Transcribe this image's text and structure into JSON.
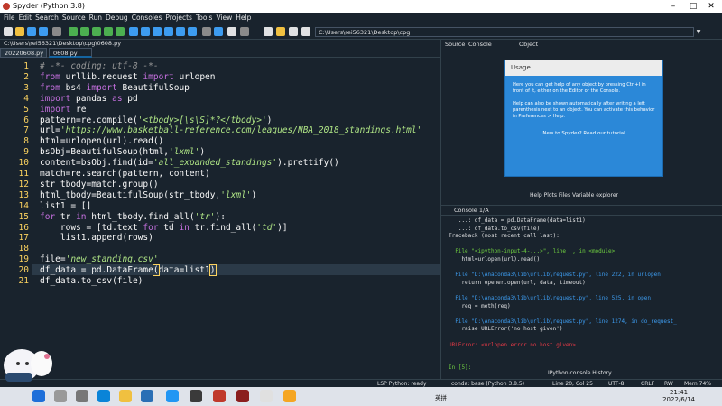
{
  "window": {
    "title": "Spyder (Python 3.8)"
  },
  "menu": [
    "File",
    "Edit",
    "Search",
    "Source",
    "Run",
    "Debug",
    "Consoles",
    "Projects",
    "Tools",
    "View",
    "Help"
  ],
  "toolbar": {
    "path": "C:\\Users\\rei56321\\Desktop\\cpg"
  },
  "editor": {
    "breadcrumb": "C:\\Users\\rei56321\\Desktop\\cpg\\0608.py",
    "tabs": [
      "20220608.py",
      "0608.py"
    ],
    "active_tab": 1,
    "lines": [
      {
        "n": "1",
        "html": "<span class='cm'># -*- coding: utf-8 -*-</span>"
      },
      {
        "n": "2",
        "html": "<span class='kw'>from</span> urllib.request <span class='kw'>import</span> urlopen"
      },
      {
        "n": "3",
        "html": "<span class='kw'>from</span> bs4 <span class='kw'>import</span> BeautifulSoup"
      },
      {
        "n": "4",
        "html": "<span class='kw'>import</span> pandas <span class='kw'>as</span> pd"
      },
      {
        "n": "5",
        "html": "<span class='kw'>import</span> re"
      },
      {
        "n": "6",
        "html": "pattern=re.compile(<span class='st'>'&lt;tbody&gt;[\\s\\S]*?&lt;/tbody&gt;'</span>)"
      },
      {
        "n": "7",
        "html": "url=<span class='st'>'https://www.basketball-reference.com/leagues/NBA_2018_standings.html'</span>"
      },
      {
        "n": "8",
        "html": "html=urlopen(url).read()"
      },
      {
        "n": "9",
        "html": "bsObj=BeautifulSoup(html,<span class='st'>'lxml'</span>)"
      },
      {
        "n": "10",
        "html": "content=bsObj.find(id=<span class='st'>'all_expanded_standings'</span>).prettify()"
      },
      {
        "n": "11",
        "html": "match=re.search(pattern, content)"
      },
      {
        "n": "12",
        "html": "str_tbody=match.group()"
      },
      {
        "n": "13",
        "html": "html_tbody=BeautifulSoup(str_tbody,<span class='st'>'lxml'</span>)"
      },
      {
        "n": "14",
        "html": "list1 = []"
      },
      {
        "n": "15",
        "html": "<span class='kw'>for</span> tr <span class='kw'>in</span> html_tbody.find_all(<span class='st'>'tr'</span>):"
      },
      {
        "n": "16",
        "html": "    rows = [td.text <span class='kw'>for</span> td <span class='kw'>in</span> tr.find_all(<span class='st'>'td'</span>)]"
      },
      {
        "n": "17",
        "html": "    list1.append(rows)"
      },
      {
        "n": "18",
        "html": ""
      },
      {
        "n": "19",
        "html": "file=<span class='st'>'new_standing.csv'</span>"
      },
      {
        "n": "20",
        "html": "df_data = pd.DataFrame<span class='hl'>(</span>data=list1<span class='hl'>)</span>"
      },
      {
        "n": "21",
        "html": "df_data.to_csv(file)"
      }
    ],
    "current_line": 20
  },
  "help_panel": {
    "tabs": [
      "Source",
      "Console",
      "Object"
    ],
    "title": "Usage",
    "p1": "Here you can get help of any object by pressing Ctrl+I in front of it, either on the Editor or the Console.",
    "p2": "Help can also be shown automatically after writing a left parenthesis next to an object. You can activate this behavior in Preferences > Help.",
    "footer": "New to Spyder? Read our tutorial",
    "bottom_tabs": "Help  Plots  Files  Variable explorer"
  },
  "console": {
    "tab": "Console 1/A",
    "lines": [
      {
        "cls": "",
        "text": "   ...: df_data = pd.DataFrame(data=list1)"
      },
      {
        "cls": "",
        "text": "   ...: df_data.to_csv(file)"
      },
      {
        "cls": "",
        "text": "Traceback (most recent call last):"
      },
      {
        "cls": "",
        "text": ""
      },
      {
        "cls": "cg",
        "text": "  File \"<ipython-input-4-...>\", line  , in <module>"
      },
      {
        "cls": "",
        "text": "    html=urlopen(url).read()"
      },
      {
        "cls": "",
        "text": ""
      },
      {
        "cls": "cb",
        "text": "  File \"D:\\Anaconda3\\lib\\urllib\\request.py\", line 222, in urlopen"
      },
      {
        "cls": "",
        "text": "    return opener.open(url, data, timeout)"
      },
      {
        "cls": "",
        "text": ""
      },
      {
        "cls": "cb",
        "text": "  File \"D:\\Anaconda3\\lib\\urllib\\request.py\", line 525, in open"
      },
      {
        "cls": "",
        "text": "    req = meth(req)"
      },
      {
        "cls": "",
        "text": ""
      },
      {
        "cls": "cb",
        "text": "  File \"D:\\Anaconda3\\lib\\urllib\\request.py\", line 1274, in do_request_"
      },
      {
        "cls": "",
        "text": "    raise URLError('no host given')"
      },
      {
        "cls": "",
        "text": ""
      },
      {
        "cls": "cr",
        "text": "URLError: <urlopen error no host given>"
      },
      {
        "cls": "",
        "text": ""
      },
      {
        "cls": "",
        "text": ""
      },
      {
        "cls": "cg",
        "text": "In [5]:"
      }
    ],
    "bottom_tabs": "IPython console  History"
  },
  "status": {
    "lsp": "LSP Python: ready",
    "conda": "conda: base (Python 3.8.5)",
    "pos": "Line 20, Col 25",
    "enc": "UTF-8",
    "eol": "CRLF",
    "rw": "RW",
    "mem": "Mem 74%"
  },
  "taskbar": {
    "time": "21:41",
    "date": "2022/6/14",
    "lang": "英拼"
  }
}
